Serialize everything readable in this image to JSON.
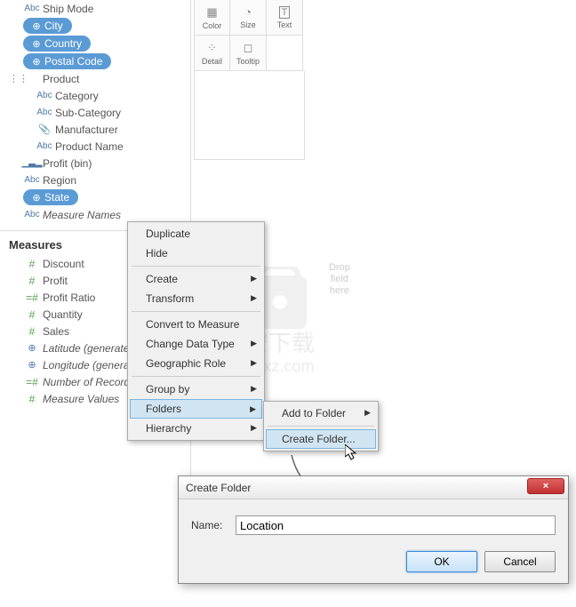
{
  "dimensions": {
    "ship_mode": "Ship Mode",
    "city": "City",
    "country": "Country",
    "postal_code": "Postal Code",
    "product_group": "Product",
    "category": "Category",
    "sub_category": "Sub-Category",
    "manufacturer": "Manufacturer",
    "product_name": "Product Name",
    "profit_bin": "Profit (bin)",
    "region": "Region",
    "state": "State",
    "measure_names": "Measure Names"
  },
  "measures_title": "Measures",
  "measures": {
    "discount": "Discount",
    "profit": "Profit",
    "profit_ratio": "Profit Ratio",
    "quantity": "Quantity",
    "sales": "Sales",
    "latitude": "Latitude (generated)",
    "longitude": "Longitude (generated)",
    "num_records": "Number of Records",
    "measure_values": "Measure Values"
  },
  "marks": {
    "color": "Color",
    "size": "Size",
    "text": "Text",
    "detail": "Detail",
    "tooltip": "Tooltip"
  },
  "drop": {
    "l1": "Drop",
    "l2": "field",
    "l3": "here"
  },
  "ctx": {
    "duplicate": "Duplicate",
    "hide": "Hide",
    "create": "Create",
    "transform": "Transform",
    "convert": "Convert to Measure",
    "change_type": "Change Data Type",
    "geo_role": "Geographic Role",
    "group_by": "Group by",
    "folders": "Folders",
    "hierarchy": "Hierarchy"
  },
  "sub": {
    "add_to_folder": "Add to Folder",
    "create_folder": "Create Folder..."
  },
  "dialog": {
    "title": "Create Folder",
    "name_label": "Name:",
    "name_value": "Location",
    "ok": "OK",
    "cancel": "Cancel",
    "close": "×"
  },
  "watermark": {
    "cn": "安下载",
    "url": "anxz.com"
  }
}
